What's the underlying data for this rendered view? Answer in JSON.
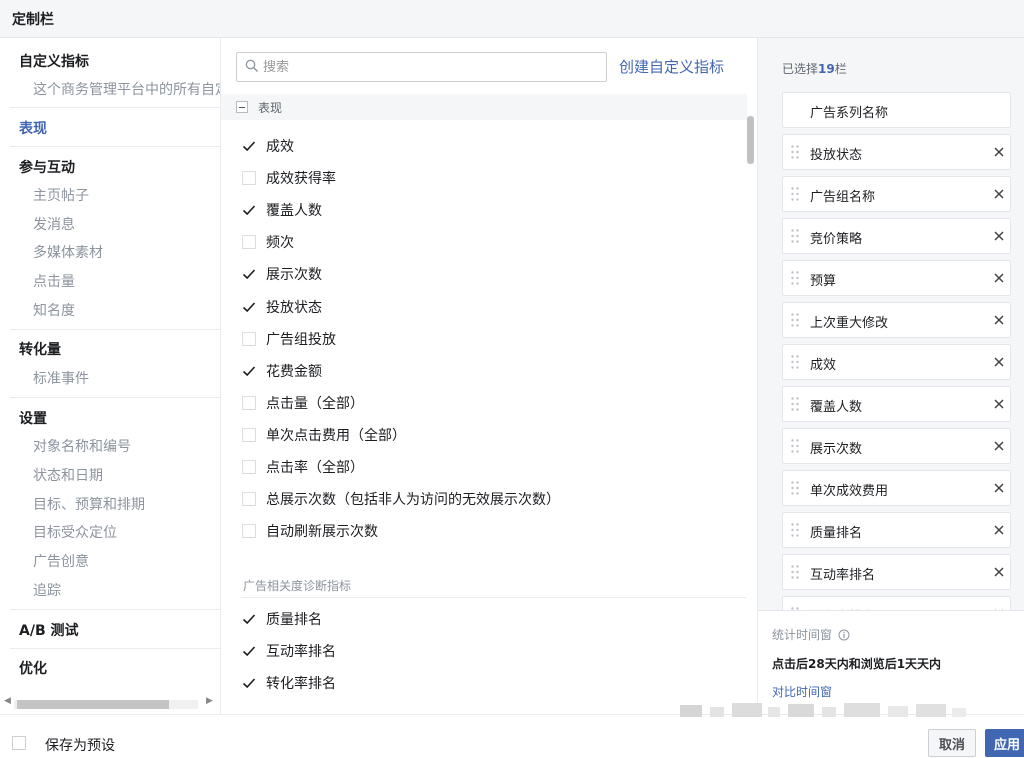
{
  "header": {
    "title": "定制栏"
  },
  "left": {
    "custom_metrics": {
      "label": "自定义指标",
      "desc": "这个商务管理平台中的所有自定义指标"
    },
    "performance": {
      "label": "表现"
    },
    "engagement": {
      "label": "参与互动",
      "items": [
        "主页帖子",
        "发消息",
        "多媒体素材",
        "点击量",
        "知名度"
      ]
    },
    "conversions": {
      "label": "转化量",
      "items": [
        "标准事件"
      ]
    },
    "settings": {
      "label": "设置",
      "items": [
        "对象名称和编号",
        "状态和日期",
        "目标、预算和排期",
        "目标受众定位",
        "广告创意",
        "追踪"
      ]
    },
    "ab_test": {
      "label": "A/B 测试"
    },
    "optimization": {
      "label": "优化"
    }
  },
  "middle": {
    "search": {
      "placeholder": "搜索"
    },
    "create_link": "创建自定义指标",
    "section_label": "表现",
    "metrics": [
      {
        "label": "成效",
        "checked": true
      },
      {
        "label": "成效获得率",
        "checked": false
      },
      {
        "label": "覆盖人数",
        "checked": true
      },
      {
        "label": "频次",
        "checked": false
      },
      {
        "label": "展示次数",
        "checked": true
      },
      {
        "label": "投放状态",
        "checked": true
      },
      {
        "label": "广告组投放",
        "checked": false
      },
      {
        "label": "花费金额",
        "checked": true
      },
      {
        "label": "点击量（全部）",
        "checked": false
      },
      {
        "label": "单次点击费用（全部）",
        "checked": false
      },
      {
        "label": "点击率（全部）",
        "checked": false
      },
      {
        "label": "总展示次数（包括非人为访问的无效展示次数）",
        "checked": false
      },
      {
        "label": "自动刷新展示次数",
        "checked": false
      }
    ],
    "subsection_label": "广告相关度诊断指标",
    "diag_metrics": [
      {
        "label": "质量排名",
        "checked": true
      },
      {
        "label": "互动率排名",
        "checked": true
      },
      {
        "label": "转化率排名",
        "checked": true
      }
    ]
  },
  "right": {
    "selected_prefix": "已选择",
    "selected_count": "19",
    "selected_suffix": "栏",
    "fixed_item": "广告系列名称",
    "items": [
      "投放状态",
      "广告组名称",
      "竞价策略",
      "预算",
      "上次重大修改",
      "成效",
      "覆盖人数",
      "展示次数",
      "单次成效费用",
      "质量排名",
      "互动率排名",
      "转化率排名"
    ],
    "window_label": "统计时间窗",
    "window_value": "点击后28天内和浏览后1天天内",
    "compare_link": "对比时间窗"
  },
  "footer": {
    "save_preset": "保存为预设",
    "cancel": "取消",
    "apply": "应用"
  },
  "colors": {
    "accent": "#4267b2",
    "panel_bg": "#f5f6f7",
    "muted": "#8d949e"
  }
}
